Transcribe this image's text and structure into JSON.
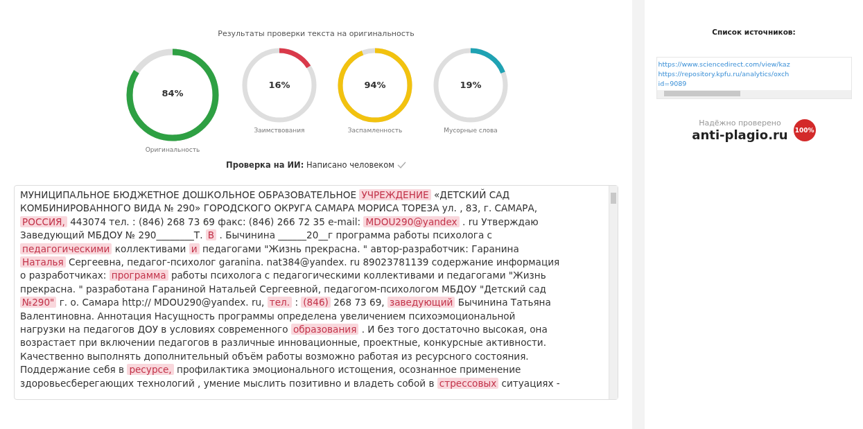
{
  "results": {
    "title": "Результаты проверки текста на оригинальность",
    "gauges": [
      {
        "value": "84%",
        "label": "Оригинальность",
        "level": 0.84,
        "color": "#2ea043",
        "kind": "large"
      },
      {
        "value": "16%",
        "label": "Заимствования",
        "level": 0.16,
        "color": "#d9394a",
        "kind": "small"
      },
      {
        "value": "94%",
        "label": "Заспамленность",
        "level": 0.94,
        "color": "#f2c20f",
        "kind": "small"
      },
      {
        "value": "19%",
        "label": "Мусорные слова",
        "level": 0.19,
        "color": "#1fa2b3",
        "kind": "small"
      }
    ],
    "ai_check": "**Проверка на ИИ:** Написано человеком"
  },
  "text": {
    "lines": [
      {
        "parts": [
          {
            "text": "МУНИЦИПАЛЬНОЕ БЮДЖЕТНОЕ ДОШКОЛЬНОЕ ОБРАЗОВАТЕЛЬНОЕ",
            "highlighted": false
          },
          {
            "text": "УЧРЕЖДЕНИЕ",
            "highlighted": true
          },
          {
            "text": "«ДЕТСКИЙ САД",
            "highlighted": false
          }
        ]
      },
      {
        "parts": [
          {
            "text": "КОМБИНИРОВАННОГО ВИДА № 290» ГОРОДСКОГО ОКРУГА САМАРА МОРИСА ТОРЕЗА ул. , 83, г. САМАРА,",
            "highlighted": false
          }
        ]
      },
      {
        "parts": [
          {
            "text": "РОССИЯ,",
            "highlighted": true
          },
          {
            "text": "443074 тел. : (846) 268 73 69 факс: (846) 266 72 35 e-mail:",
            "highlighted": false
          },
          {
            "text": "MDOU290@yandex",
            "highlighted": true
          },
          {
            "text": ". ru Утверждаю",
            "highlighted": false
          }
        ]
      },
      {
        "parts": [
          {
            "text": "Заведующий МБДОУ № 290________Т.",
            "highlighted": false
          },
          {
            "text": "В",
            "highlighted": true
          },
          {
            "text": ". Бычинина ______20__г программа работы психолога с",
            "highlighted": false
          }
        ]
      },
      {
        "parts": [
          {
            "text": "педагогическими",
            "highlighted": true
          },
          {
            "text": "коллективами",
            "highlighted": false
          },
          {
            "text": "и",
            "highlighted": true
          },
          {
            "text": "педагогами \"Жизнь прекрасна. \" автор-разработчик: Гаранина",
            "highlighted": false
          }
        ]
      },
      {
        "parts": [
          {
            "text": "Наталья",
            "highlighted": true
          },
          {
            "text": "Сергеевна, педагог-психолог garanina. nat384@yandex. ru 89023781139 содержание информация",
            "highlighted": false
          }
        ]
      },
      {
        "parts": [
          {
            "text": "о разработчиках:",
            "highlighted": false
          },
          {
            "text": "программа",
            "highlighted": true
          },
          {
            "text": "работы психолога с педагогическими коллективами и педагогами \"Жизнь",
            "highlighted": false
          }
        ]
      },
      {
        "parts": [
          {
            "text": "прекрасна. \" разработана Гараниной Натальей Сергеевной, педагогом-психологом МБДОУ \"Детский сад",
            "highlighted": false
          }
        ]
      },
      {
        "parts": [
          {
            "text": "№290\"",
            "highlighted": true
          },
          {
            "text": "г. о. Самара http:// MDOU290@yandex. ru,",
            "highlighted": false
          },
          {
            "text": "тел.",
            "highlighted": true
          },
          {
            "text": ":",
            "highlighted": false
          },
          {
            "text": "(846)",
            "highlighted": true
          },
          {
            "text": "268 73 69,",
            "highlighted": false
          },
          {
            "text": "заведующий",
            "highlighted": true
          },
          {
            "text": "Бычинина Татьяна",
            "highlighted": false
          }
        ]
      },
      {
        "parts": [
          {
            "text": "Валентиновна. Аннотация Насущность программы определена увеличением психоэмоциональной",
            "highlighted": false
          }
        ]
      },
      {
        "parts": [
          {
            "text": "нагрузки на педагогов ДОУ в условиях современного",
            "highlighted": false
          },
          {
            "text": "образования",
            "highlighted": true
          },
          {
            "text": ". И без того достаточно высокая, она",
            "highlighted": false
          }
        ]
      },
      {
        "parts": [
          {
            "text": "возрастает при включении педагогов в различные инновационные, проектные, конкурсные активности.",
            "highlighted": false
          }
        ]
      },
      {
        "parts": [
          {
            "text": "Качественно выполнять дополнительный объём работы возможно работая из ресурсного состояния.",
            "highlighted": false
          }
        ]
      },
      {
        "parts": [
          {
            "text": "Поддержание себя в",
            "highlighted": false
          },
          {
            "text": "ресурсе,",
            "highlighted": true
          },
          {
            "text": "профилактика эмоционального истощения, осознанное применение",
            "highlighted": false
          }
        ]
      },
      {
        "parts": [
          {
            "text": "здоровьесберегающих технологий , умение мыслить позитивно и владеть собой в",
            "highlighted": false
          },
          {
            "text": "стрессовых",
            "highlighted": true
          },
          {
            "text": "ситуациях -",
            "highlighted": false
          }
        ]
      }
    ]
  },
  "sources": {
    "title": "Список источников:",
    "links": [
      "https://www.sciencedirect.com/view/kaz",
      "https://repository.kpfu.ru/analytics/oxch",
      "id=9089"
    ]
  },
  "badge": {
    "caption": "Надёжно проверено",
    "site": "anti-plagio.ru",
    "seal": "100%"
  }
}
